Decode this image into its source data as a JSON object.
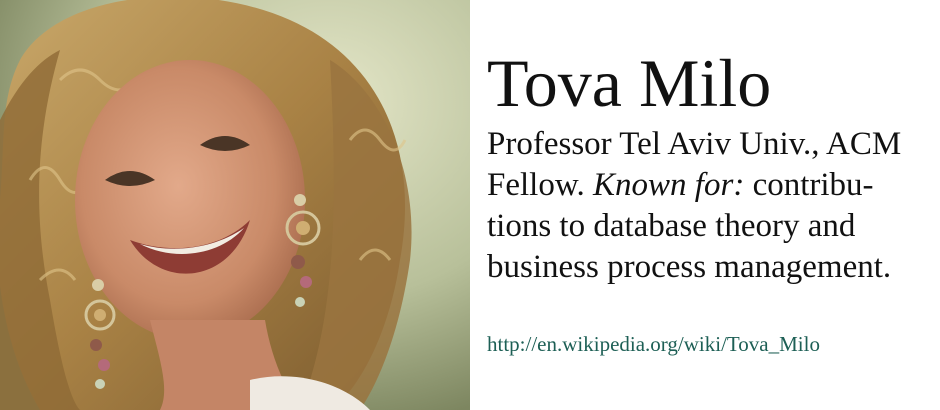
{
  "name": "Tova Milo",
  "description": {
    "line1": "Professor Tel Aviv Univ., ACM",
    "line2_prefix": "Fellow. ",
    "known_for_label": "Known for:",
    "line2_suffix": " contribu-",
    "line3": "tions to database theory and",
    "line4": "business process management."
  },
  "link": {
    "text": "http://en.wikipedia.org/wiki/Tova_Milo"
  },
  "colors": {
    "link": "#1d5f55",
    "text": "#111111"
  }
}
